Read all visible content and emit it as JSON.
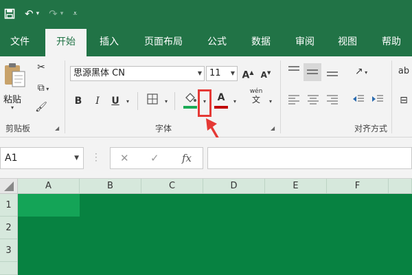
{
  "ribbon_tabs": [
    "文件",
    "开始",
    "插入",
    "页面布局",
    "公式",
    "数据",
    "审阅",
    "视图",
    "帮助"
  ],
  "active_tab": "开始",
  "clipboard": {
    "paste_label": "粘贴",
    "group_label": "剪贴板"
  },
  "font": {
    "font_name": "思源黑体 CN",
    "font_size": "11",
    "grow_label": "A",
    "shrink_label": "A",
    "bold": "B",
    "italic": "I",
    "underline": "U",
    "font_color_label": "A",
    "phonetic_top": "wén",
    "phonetic_bottom": "文",
    "group_label": "字体"
  },
  "alignment": {
    "group_label": "对齐方式"
  },
  "extra": {
    "text_label": "ab"
  },
  "formula_bar": {
    "cell_ref": "A1",
    "fx_label": "fx"
  },
  "columns": [
    "A",
    "B",
    "C",
    "D",
    "E",
    "F"
  ],
  "rows": [
    "1",
    "2",
    "3"
  ],
  "colors": {
    "brand": "#217346",
    "selection": "#078241",
    "active_cell": "#14a457",
    "fill_underline": "#1aaa55",
    "font_underline": "#c00000",
    "highlight": "#e53935"
  }
}
